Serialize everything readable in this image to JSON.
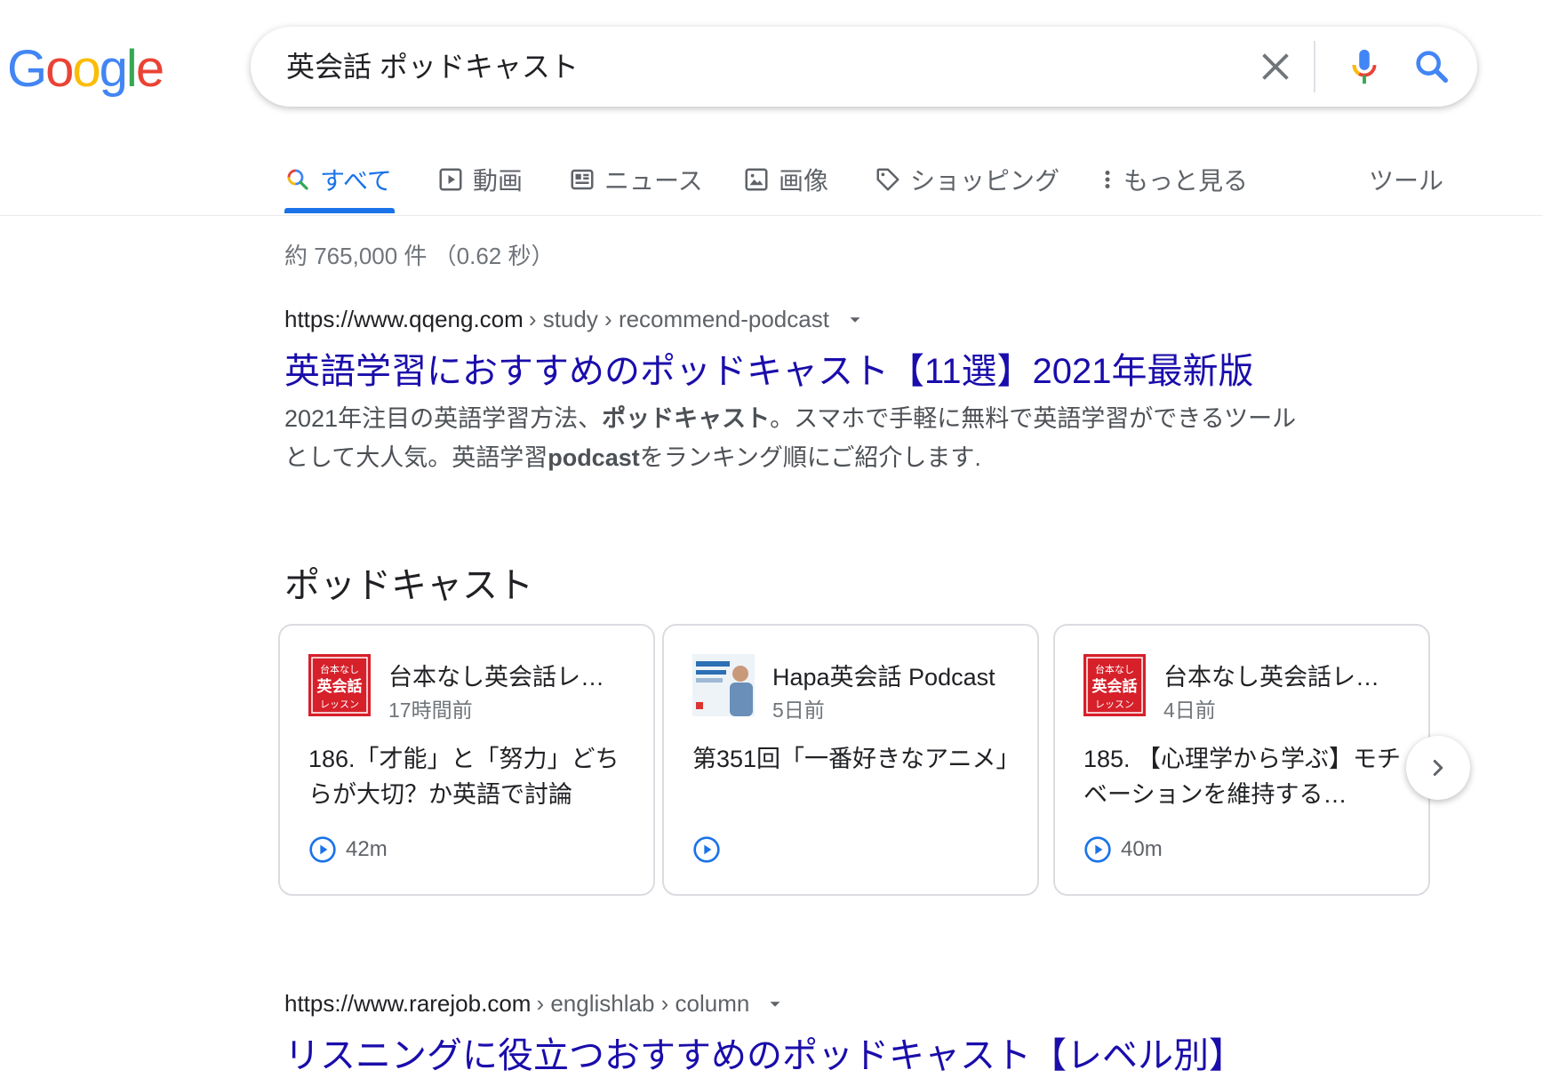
{
  "logo": {
    "letters": [
      "G",
      "o",
      "o",
      "g",
      "l",
      "e"
    ],
    "colors": [
      "#4285F4",
      "#EA4335",
      "#FBBC05",
      "#4285F4",
      "#34A853",
      "#EA4335"
    ]
  },
  "search": {
    "query": "英会話 ポッドキャスト"
  },
  "tabs": [
    {
      "label": "すべて",
      "icon": "search-icon",
      "active": true
    },
    {
      "label": "動画",
      "icon": "video-icon"
    },
    {
      "label": "ニュース",
      "icon": "news-icon"
    },
    {
      "label": "画像",
      "icon": "image-icon"
    },
    {
      "label": "ショッピング",
      "icon": "tag-icon"
    },
    {
      "label": "もっと見る",
      "icon": "more-vert-icon"
    },
    {
      "label": "ツール"
    }
  ],
  "stats": "約 765,000 件 （0.62 秒）",
  "results": [
    {
      "url_host": "https://www.qqeng.com",
      "url_path": "› study › recommend-podcast",
      "title": "英語学習におすすめのポッドキャスト【11選】2021年最新版",
      "snippet_1a": "2021年注目の英語学習方法、",
      "snippet_1b": "ポッドキャスト",
      "snippet_1c": "。スマホで手軽に無料で英語学習ができるツール",
      "snippet_2a": "として大人気。英語学習",
      "snippet_2b": "podcast",
      "snippet_2c": "をランキング順にご紹介します."
    },
    {
      "url_host": "https://www.rarejob.com",
      "url_path": "› englishlab › column",
      "title": "リスニングに役立つおすすめのポッドキャスト【レベル別】"
    }
  ],
  "podcasts": {
    "heading": "ポッドキャスト",
    "cards": [
      {
        "show": "台本なし英会話レ…",
        "age": "17時間前",
        "episode": "186.「才能」と「努力」どちらが大切？か英語で討論",
        "duration": "42m",
        "thumb_text": [
          "台本なし",
          "英会話",
          "レッスン"
        ]
      },
      {
        "show": "Hapa英会話 Podcast",
        "age": "5日前",
        "episode": "第351回「一番好きなアニメ」",
        "duration": ""
      },
      {
        "show": "台本なし英会話レ…",
        "age": "4日前",
        "episode": "185. 【心理学から学ぶ】モチベーションを維持する…",
        "duration": "40m",
        "thumb_text": [
          "台本なし",
          "英会話",
          "レッスン"
        ]
      }
    ]
  },
  "colors": {
    "link": "#1a0dab",
    "accent": "#1a73e8",
    "muted": "#70757a"
  }
}
